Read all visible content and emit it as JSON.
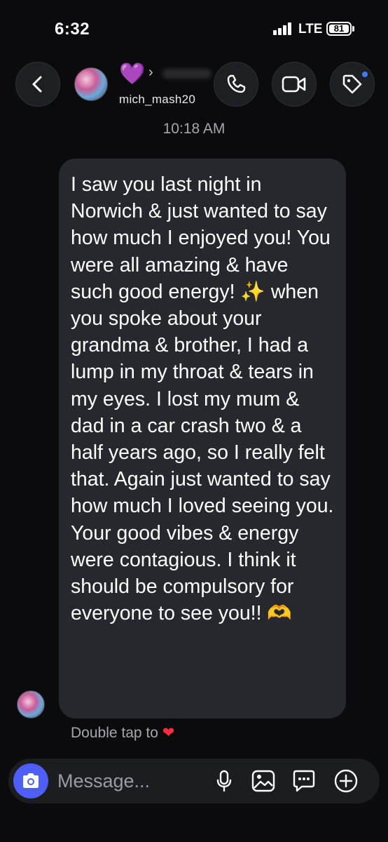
{
  "status_bar": {
    "time": "6:32",
    "network": "LTE",
    "battery": "81"
  },
  "header": {
    "display_name_emoji": "💜",
    "chevron": "›",
    "username": "mich_mash20"
  },
  "thread": {
    "timestamp": "10:18 AM",
    "message": {
      "part1": "I saw you last night in Norwich & just wanted to say how much I enjoyed you! You were all amazing & have such good energy! ",
      "sparkle": "✨",
      "part2": " when you spoke about your grandma & brother, I had a lump in my throat & tears in my eyes. I lost my mum & dad in a car crash two & a half years ago, so I really felt that. Again just wanted to say how much I loved seeing you. Your good vibes & energy were contagious. I think it should be compulsory for everyone to see you!! ",
      "hands": "🫶"
    },
    "hint_text": "Double tap to",
    "hint_heart": "❤"
  },
  "composer": {
    "placeholder": "Message..."
  },
  "icons": {
    "back": "chevron-left-icon",
    "call": "phone-icon",
    "video": "video-camera-icon",
    "tag": "tag-icon",
    "camera": "camera-icon",
    "mic": "microphone-icon",
    "gallery": "image-icon",
    "sticker": "sticker-icon",
    "plus": "plus-icon"
  },
  "colors": {
    "bubble": "#26282e",
    "accent": "#4f5ef7",
    "notification": "#3f7cf6"
  }
}
